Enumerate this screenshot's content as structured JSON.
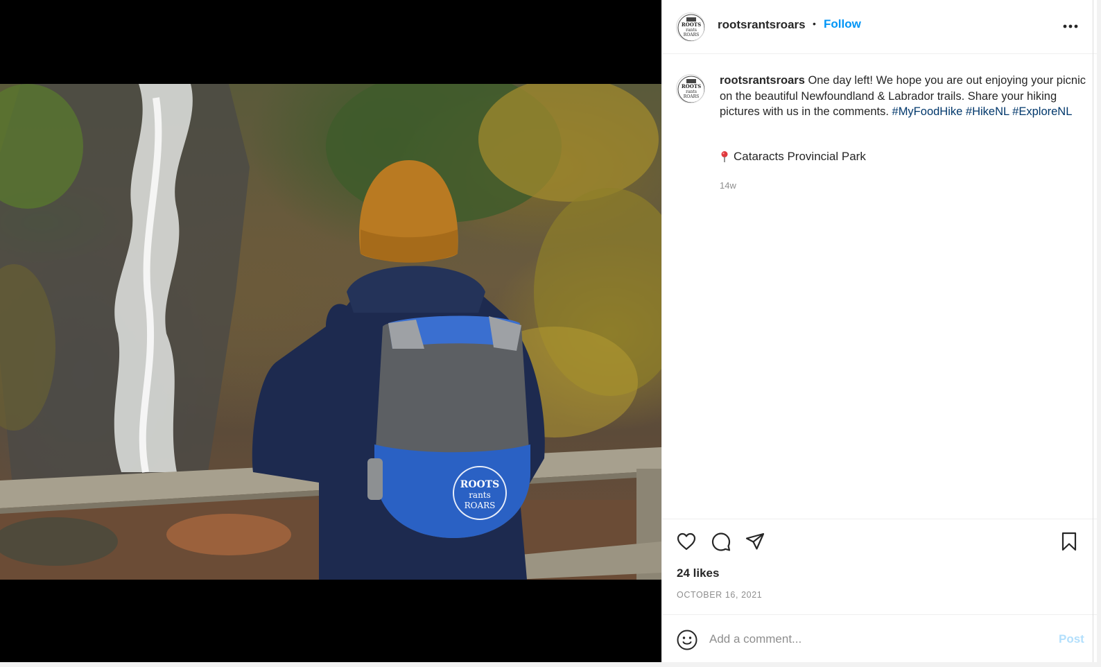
{
  "post": {
    "username": "rootsrantsroars",
    "follow_label": "Follow",
    "separator": "•",
    "caption_user": "rootsrantsroars",
    "caption_text": " One day left! We hope you are out enjoying your picnic on the beautiful Newfoundland & Labrador trails. Share your hiking pictures with us in the comments. ",
    "hashtags": [
      "#MyFoodHike",
      "#HikeNL",
      "#ExploreNL"
    ],
    "location": "Cataracts Provincial Park",
    "time_ago": "14w",
    "likes": "24 likes",
    "date": "OCTOBER 16, 2021"
  },
  "comment": {
    "placeholder": "Add a comment...",
    "post_label": "Post"
  },
  "icons": {
    "more": "more-options-icon",
    "like": "heart-icon",
    "comment": "comment-bubble-icon",
    "share": "paper-plane-icon",
    "save": "bookmark-icon",
    "emoji": "smiley-icon",
    "location": "pin-icon"
  },
  "colors": {
    "link_blue": "#0095f6",
    "hashtag": "#00376b",
    "muted": "#8e8e8e",
    "post_disabled": "#b2dffc"
  },
  "avatar_text": [
    "ROOTS",
    "rants",
    "ROARS"
  ],
  "backpack_logo_text": [
    "ROOTS",
    "rants",
    "ROARS"
  ]
}
